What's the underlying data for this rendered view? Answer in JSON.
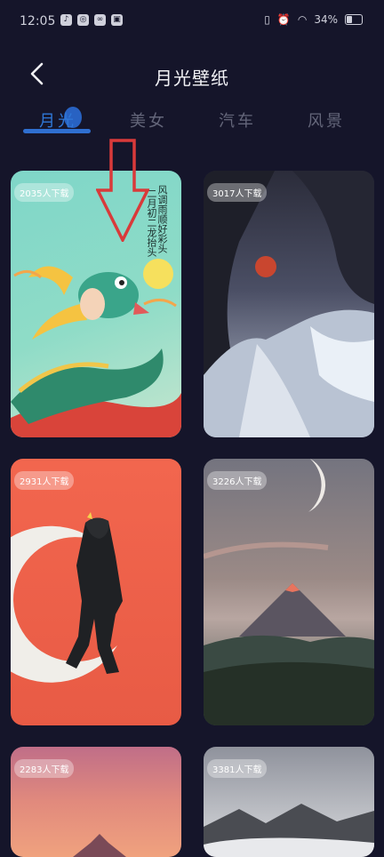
{
  "status_bar": {
    "time": "12:05",
    "battery": "34%"
  },
  "header": {
    "title": "月光壁纸"
  },
  "tabs": [
    {
      "label": "月光",
      "active": true
    },
    {
      "label": "美女",
      "active": false
    },
    {
      "label": "汽车",
      "active": false
    },
    {
      "label": "风景",
      "active": false
    }
  ],
  "wallpapers": [
    {
      "downloads": "2035人下载",
      "poem": [
        "风调雨顺好彩头",
        "二月初二龙抬头"
      ]
    },
    {
      "downloads": "3017人下载"
    },
    {
      "downloads": "2931人下载"
    },
    {
      "downloads": "3226人下载"
    },
    {
      "downloads": "2283人下载"
    },
    {
      "downloads": "3381人下载"
    }
  ],
  "colors": {
    "background": "#15152a",
    "accent": "#2f78d8",
    "annotation_arrow": "#d93a3a"
  }
}
